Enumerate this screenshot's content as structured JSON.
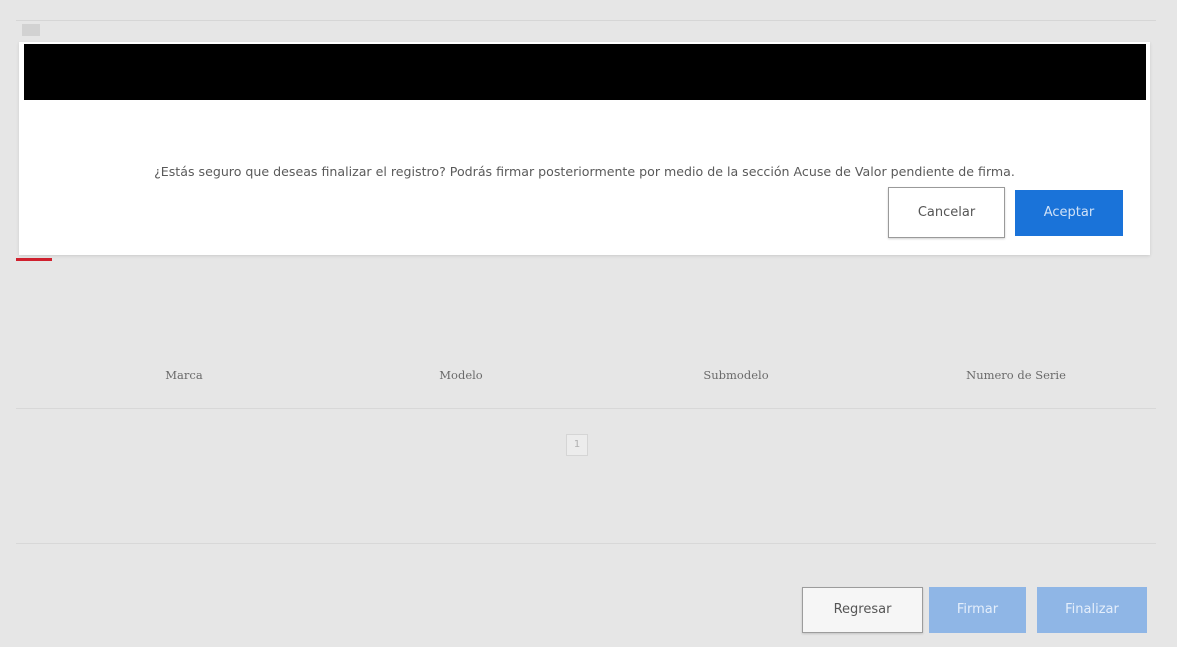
{
  "modal": {
    "message": "¿Estás seguro que deseas finalizar el registro? Podrás firmar posteriormente por medio de la sección Acuse de Valor pendiente de firma.",
    "cancel_label": "Cancelar",
    "accept_label": "Aceptar"
  },
  "table": {
    "columns": [
      "Marca",
      "Modelo",
      "Submodelo",
      "Numero de Serie"
    ]
  },
  "pagination": {
    "current_page": "1"
  },
  "footer": {
    "back_label": "Regresar",
    "sign_label": "Firmar",
    "finish_label": "Finalizar"
  },
  "colors": {
    "primary": "#1a73d9",
    "primary_disabled": "#8fb6e6",
    "accent_red": "#d0202e",
    "modal_header": "#000000",
    "backdrop": "#e6e6e6"
  }
}
